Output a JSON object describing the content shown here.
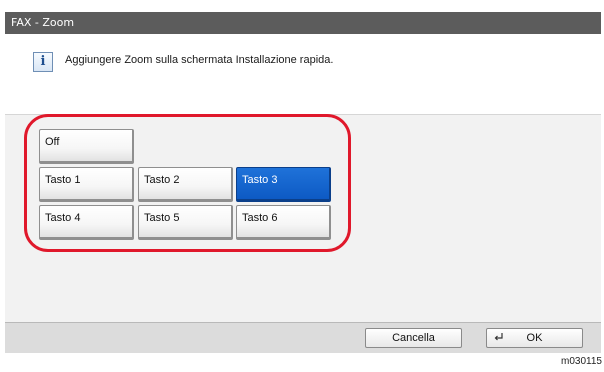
{
  "window": {
    "title": "FAX - Zoom"
  },
  "info": {
    "icon": "info-icon",
    "message": "Aggiungere Zoom sulla schermata Installazione rapida."
  },
  "keys": {
    "off": "Off",
    "tasto1": "Tasto 1",
    "tasto2": "Tasto 2",
    "tasto3": "Tasto 3",
    "tasto4": "Tasto 4",
    "tasto5": "Tasto 5",
    "tasto6": "Tasto 6",
    "selected": "Tasto 3"
  },
  "footer": {
    "cancel_label": "Cancella",
    "ok_label": "OK",
    "ok_icon": "enter-icon"
  },
  "caption": "m030115",
  "colors": {
    "highlight": "#e0182b",
    "selected": "#0d5ac4",
    "titlebar": "#5c5c5c"
  }
}
